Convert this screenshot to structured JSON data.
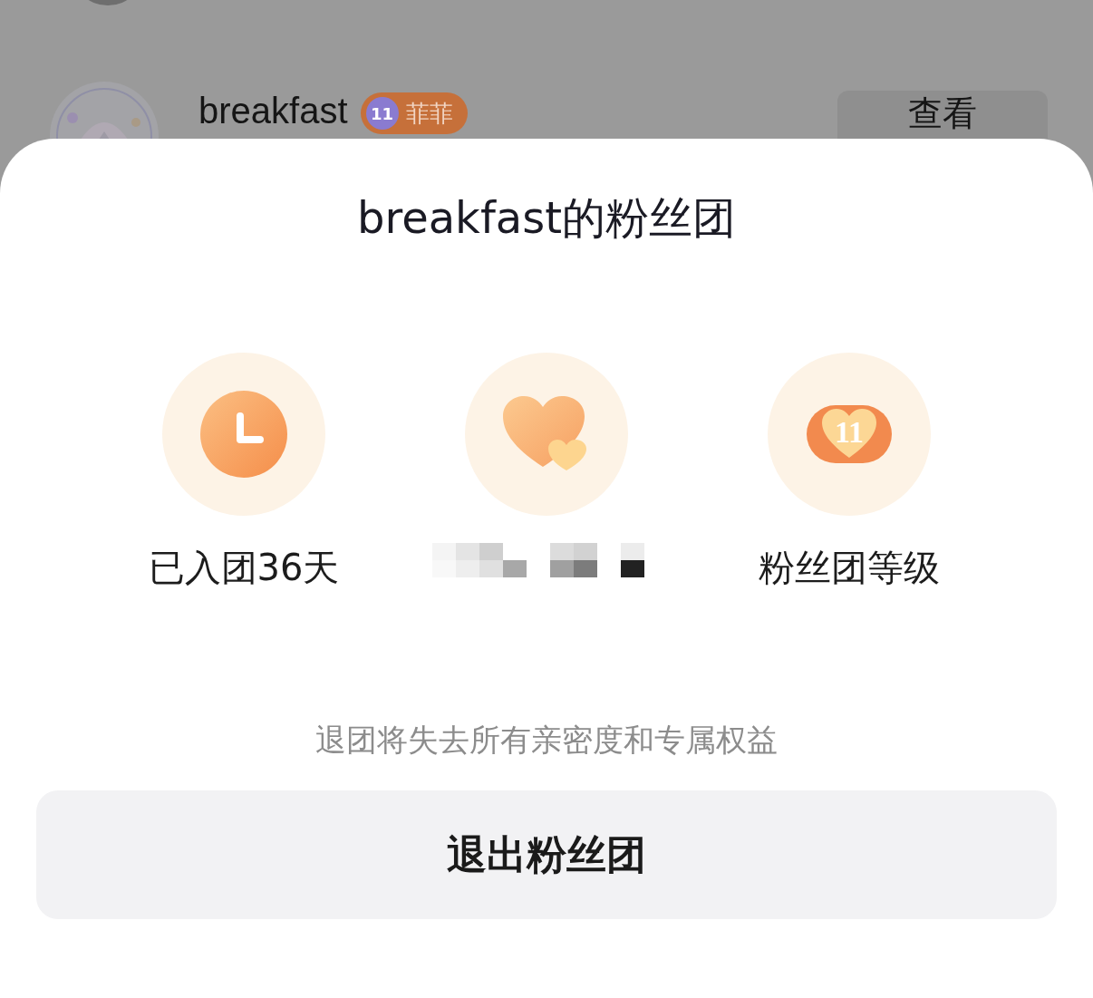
{
  "background_list": {
    "user": {
      "name": "breakfast",
      "badge_level": "11",
      "badge_name": "菲菲",
      "button": "查看"
    }
  },
  "sheet": {
    "title": "breakfast的粉丝团",
    "stats": [
      {
        "kind": "clock",
        "label": "已入团36天"
      },
      {
        "kind": "heart"
      },
      {
        "kind": "level",
        "badge_level": "11",
        "label": "粉丝团等级"
      }
    ],
    "notice": "退团将失去所有亲密度和专属权益",
    "quit_button": "退出粉丝团"
  }
}
